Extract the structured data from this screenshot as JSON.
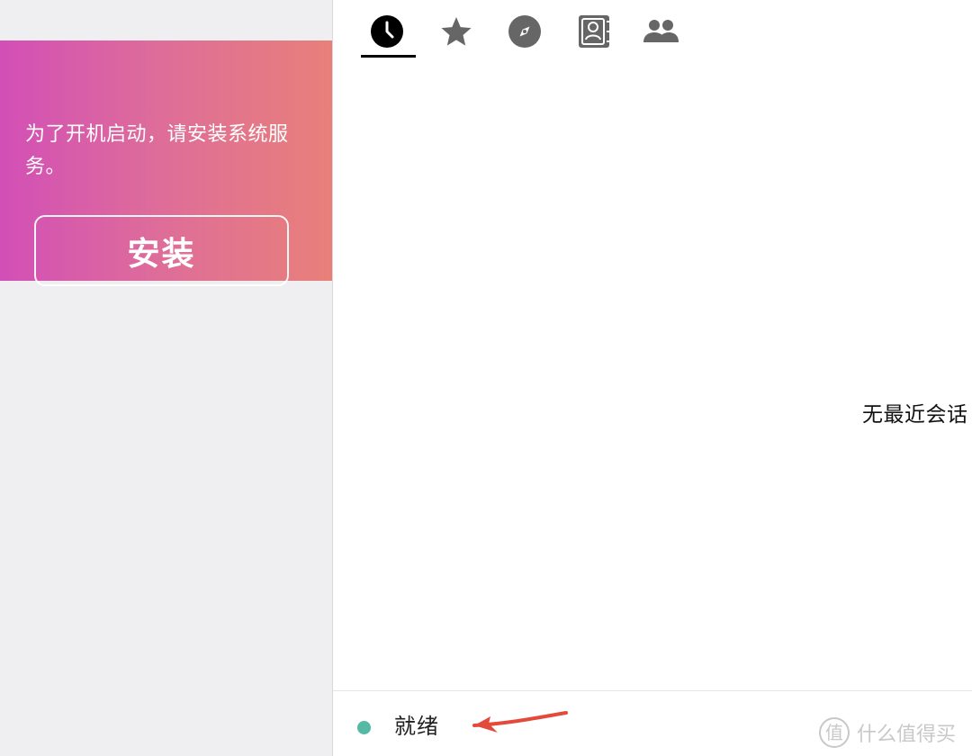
{
  "sidebar": {
    "install_banner": {
      "message": "为了开机启动，请安装系统服务。",
      "button_label": "安装",
      "gradient_colors": [
        "#d24fb7",
        "#de6d99",
        "#e8807a"
      ]
    }
  },
  "tabs": [
    {
      "name": "recent",
      "icon": "clock-icon",
      "selected": true
    },
    {
      "name": "favorites",
      "icon": "star-icon",
      "selected": false
    },
    {
      "name": "discover",
      "icon": "compass-icon",
      "selected": false
    },
    {
      "name": "contacts",
      "icon": "contact-book-icon",
      "selected": false
    },
    {
      "name": "groups",
      "icon": "people-icon",
      "selected": false
    }
  ],
  "main": {
    "empty_state": "无最近会话"
  },
  "status": {
    "label": "就绪",
    "dot_color": "#56b9a3",
    "annotation_color": "#e34a3b"
  },
  "watermark": {
    "logo": "值",
    "text": "什么值得买"
  }
}
